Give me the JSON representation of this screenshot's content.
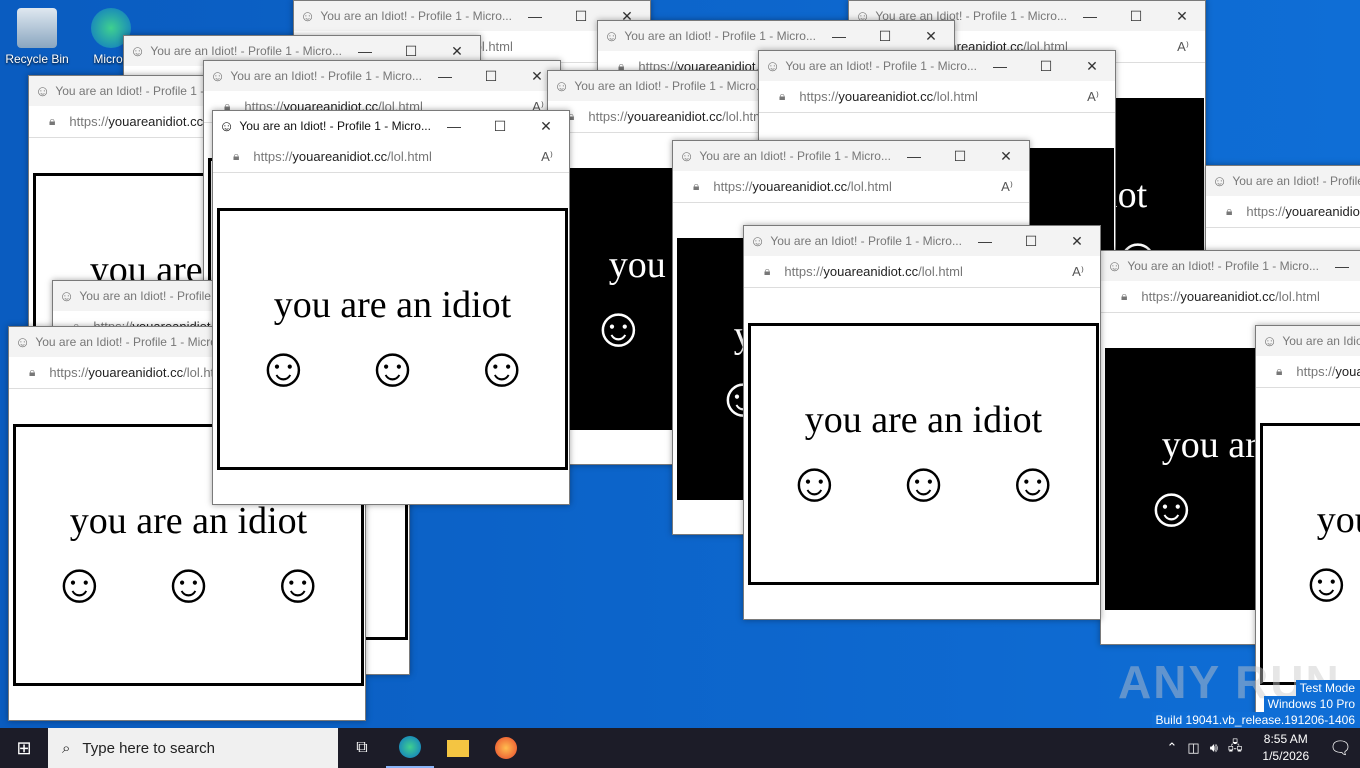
{
  "desktop": {
    "icons": [
      {
        "label": "Recycle Bin"
      },
      {
        "label": "Micros"
      }
    ],
    "watermark": {
      "line1": "Test Mode",
      "line2": "Windows 10 Pro",
      "line3": "Build 19041.vb_release.191206-1406"
    }
  },
  "browser": {
    "title": "You are an Idiot! - Profile 1 - Micro...",
    "url_scheme": "https://",
    "url_host": "youareanidiot.cc",
    "url_path": "/lol.html",
    "caption": "you are an idiot",
    "smiley": "☺",
    "minimize": "—",
    "maximize": "☐",
    "close": "✕"
  },
  "windows": [
    {
      "theme": "white"
    },
    {
      "theme": "black"
    },
    {
      "theme": "white"
    },
    {
      "theme": "white"
    },
    {
      "theme": "white"
    },
    {
      "theme": "white"
    },
    {
      "theme": "black"
    },
    {
      "theme": "black"
    },
    {
      "theme": "black"
    },
    {
      "theme": "white"
    },
    {
      "theme": "white"
    },
    {
      "theme": "white"
    },
    {
      "theme": "white"
    },
    {
      "theme": "black"
    },
    {
      "theme": "white"
    },
    {
      "theme": "white"
    }
  ],
  "taskbar": {
    "search_placeholder": "Type here to search",
    "time": "8:55 AM",
    "date": "1/5/2026"
  },
  "watermark_brand": "ANY RUN"
}
